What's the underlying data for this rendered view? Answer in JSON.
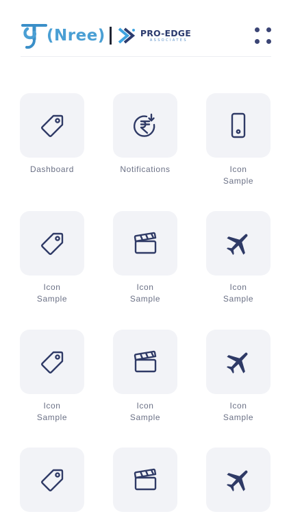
{
  "header": {
    "brand_nree": "(Nree)",
    "partner_name": "PRO-EDGE",
    "partner_sub": "ASSOCIATES",
    "menu_icon": "grid-dots-icon"
  },
  "colors": {
    "tile_bg": "#f2f3f7",
    "icon": "#2f3a66",
    "label": "#6a7085",
    "brand_blue": "#4a9fd4",
    "partner_navy": "#2c3b6e"
  },
  "tiles": [
    {
      "label": "Dashboard",
      "icon": "tag-icon"
    },
    {
      "label": "Notifications",
      "icon": "rupee-arrow-icon"
    },
    {
      "label": "Icon\nSample",
      "icon": "smartphone-icon"
    },
    {
      "label": "Icon\nSample",
      "icon": "tag-icon"
    },
    {
      "label": "Icon\nSample",
      "icon": "clapperboard-icon"
    },
    {
      "label": "Icon\nSample",
      "icon": "airplane-icon"
    },
    {
      "label": "Icon\nSample",
      "icon": "tag-icon"
    },
    {
      "label": "Icon\nSample",
      "icon": "clapperboard-icon"
    },
    {
      "label": "Icon\nSample",
      "icon": "airplane-icon"
    },
    {
      "label": "",
      "icon": "tag-icon"
    },
    {
      "label": "",
      "icon": "clapperboard-icon"
    },
    {
      "label": "",
      "icon": "airplane-icon"
    }
  ]
}
